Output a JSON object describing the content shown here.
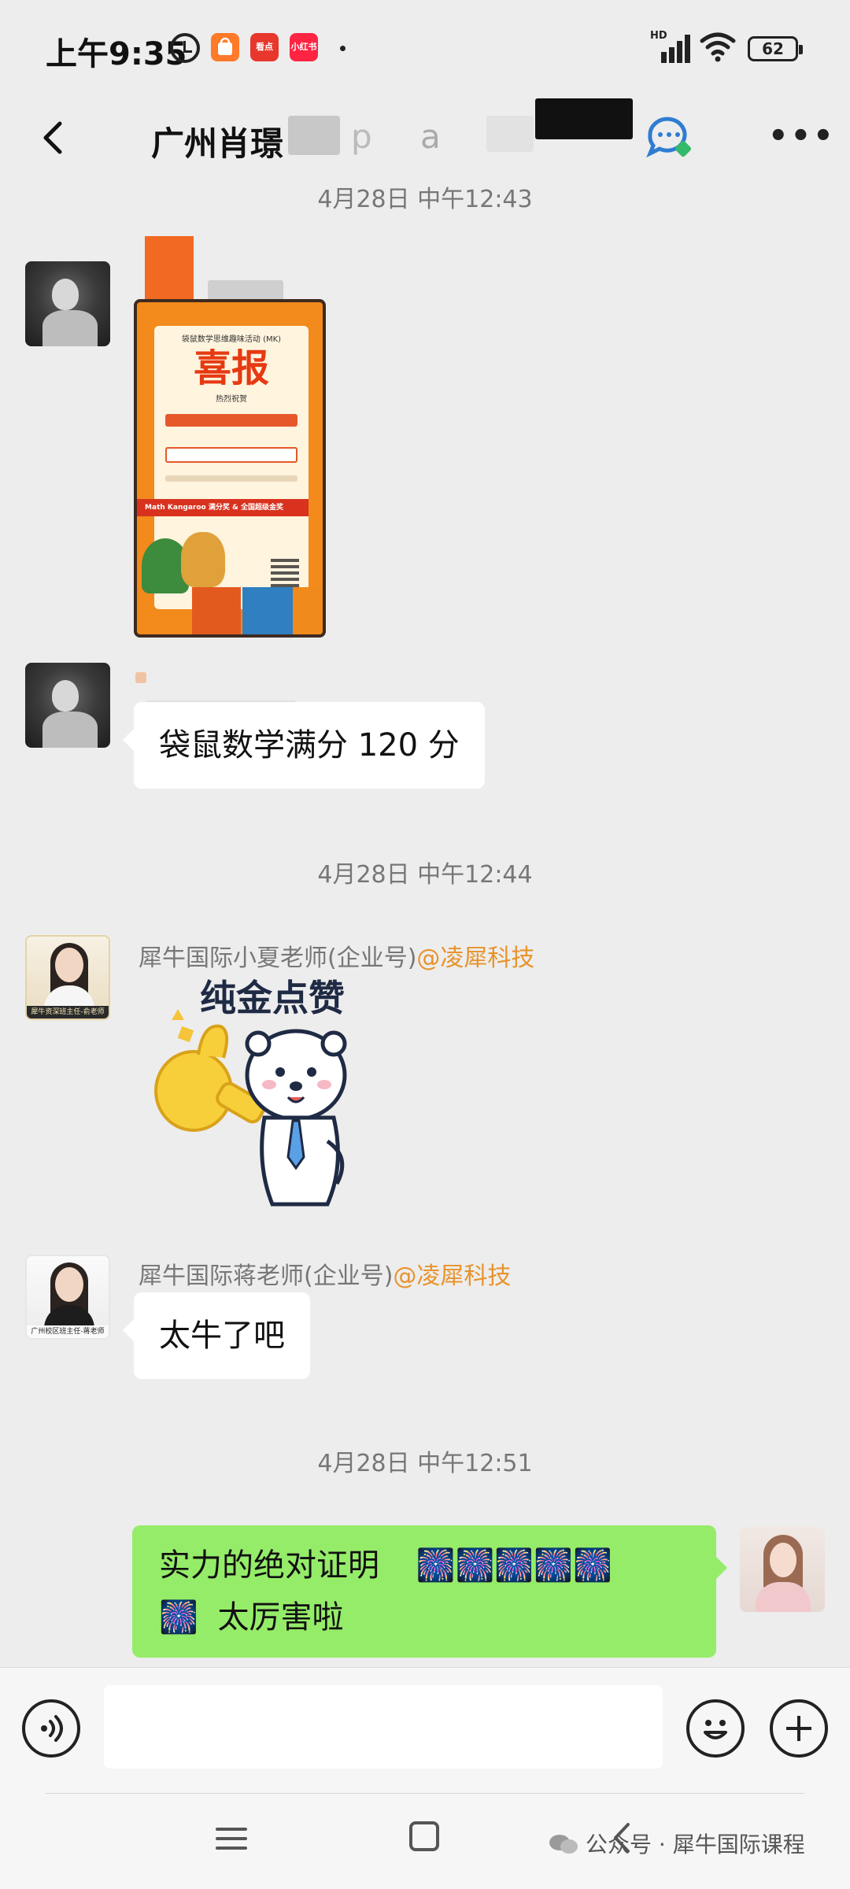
{
  "status_bar": {
    "time": "上午9:35",
    "apps": [
      "看点",
      "小红书"
    ],
    "battery": "62",
    "hd": "HD"
  },
  "header": {
    "title": "广州肖璟",
    "title_fragment_1": "p",
    "title_fragment_2": "a"
  },
  "messages": {
    "ts1": "4月28日 中午12:43",
    "poster": {
      "org": "袋鼠数学思维趣味活动 (MK)",
      "headline": "喜报",
      "sub": "热烈祝贺",
      "band": "Math Kangaroo 满分奖 & 全国超级金奖"
    },
    "text1": "袋鼠数学满分 120 分",
    "ts2": "4月28日 中午12:44",
    "sender1_name": "犀牛国际小夏老师(企业号)",
    "sender1_tag": "@凌犀科技",
    "sender1_avatar_caption": "犀牛资深班主任-俞老师",
    "sticker_text": "纯金点赞",
    "sender2_name": "犀牛国际蒋老师(企业号)",
    "sender2_tag": "@凌犀科技",
    "sender2_avatar_caption": "广州校区班主任-蒋老师",
    "text2": "太牛了吧",
    "ts3": "4月28日 中午12:51",
    "mine_line1": "实力的绝对证明",
    "mine_line2": "太厉害啦",
    "firework": "🎆"
  },
  "input": {
    "placeholder": ""
  },
  "watermark": "公众号 · 犀牛国际课程",
  "colors": {
    "bubble_mine": "#95ec69",
    "bubble_other": "#ffffff",
    "background": "#ededed",
    "tag": "#e8932b"
  }
}
